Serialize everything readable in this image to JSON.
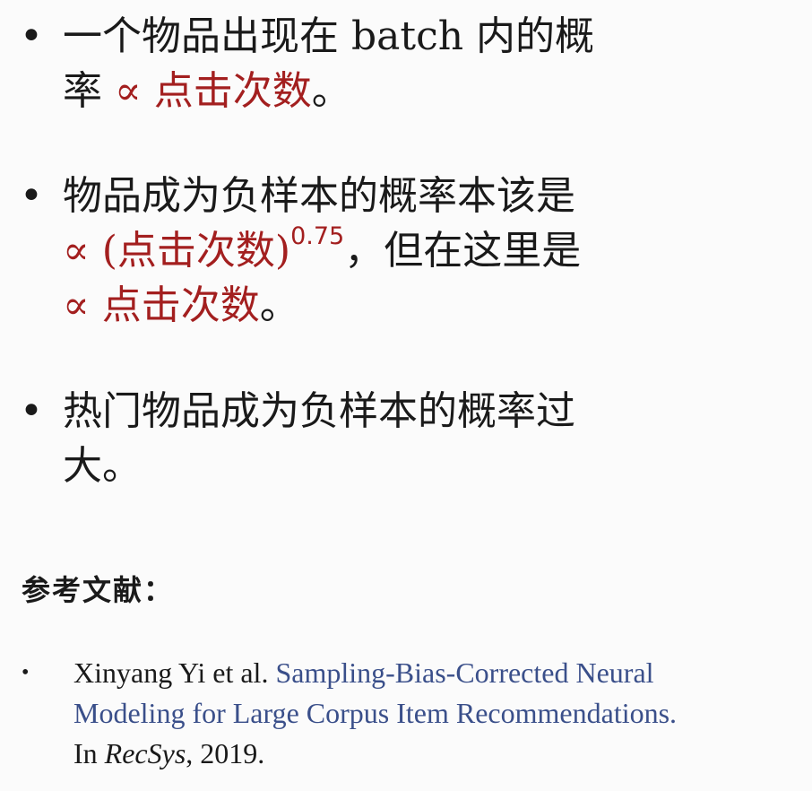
{
  "bullets": [
    {
      "lines": [
        [
          {
            "text": "一个物品出现在 batch 内的概",
            "red": false
          }
        ],
        [
          {
            "text": "率 ",
            "red": false
          },
          {
            "text": "∝ 点击次数",
            "red": true
          },
          {
            "text": "。",
            "red": false
          }
        ]
      ]
    },
    {
      "lines": [
        [
          {
            "text": "物品成为负样本的概率本该是",
            "red": false
          }
        ],
        [
          {
            "text": "∝ (点击次数)",
            "red": true
          },
          {
            "text": "0.75",
            "red": true,
            "sup": true
          },
          {
            "text": "，但在这里是",
            "red": false
          }
        ],
        [
          {
            "text": "∝ 点击次数",
            "red": true
          },
          {
            "text": "。",
            "red": false
          }
        ]
      ]
    },
    {
      "lines": [
        [
          {
            "text": "热门物品成为负样本的概率过",
            "red": false
          }
        ],
        [
          {
            "text": "大。",
            "red": false
          }
        ]
      ]
    }
  ],
  "references": {
    "heading": "参考文献：",
    "items": [
      {
        "authors": "Xinyang Yi et al. ",
        "title_line1": "Sampling-Bias-Corrected Neural",
        "title_line2": "Modeling for Large Corpus Item Recommendations.",
        "venue_prefix": "In ",
        "venue": "RecSys",
        "year_suffix": ", 2019."
      }
    ]
  },
  "colors": {
    "text": "#1a1a1a",
    "highlight_red": "#a31f1f",
    "link_blue": "#3a4f8a",
    "background": "#fbfbfb"
  }
}
